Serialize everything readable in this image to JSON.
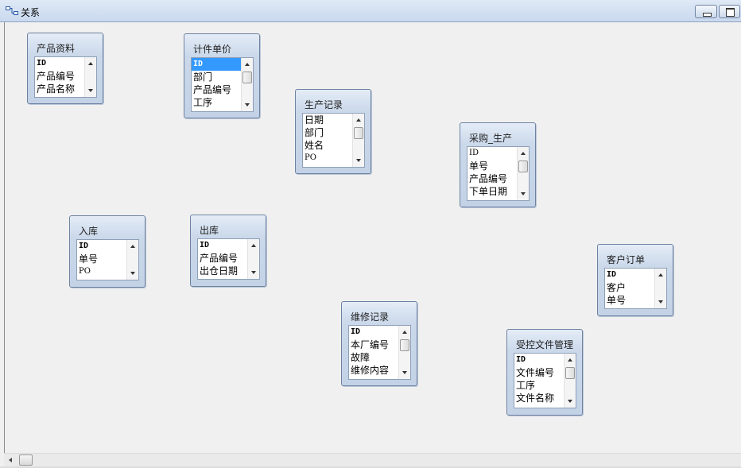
{
  "window": {
    "title": "关系"
  },
  "tables": [
    {
      "id": "chanpin-ziliao",
      "name": "产品资料",
      "fields": [
        "ID",
        "产品编号",
        "产品名称"
      ],
      "scroll_thumb": false
    },
    {
      "id": "jijian-danjia",
      "name": "计件单价",
      "fields": [
        "ID",
        "部门",
        "产品编号",
        "工序"
      ],
      "selected_field": "ID",
      "scroll_thumb": true
    },
    {
      "id": "shengchan-jilu",
      "name": "生产记录",
      "fields": [
        "日期",
        "部门",
        "姓名",
        "PO"
      ],
      "scroll_thumb": true
    },
    {
      "id": "caigou-shengchan",
      "name": "采购_生产",
      "fields": [
        "ID",
        "单号",
        "产品编号",
        "下单日期"
      ],
      "scroll_thumb": true
    },
    {
      "id": "ruku",
      "name": "入库",
      "fields": [
        "ID",
        "单号",
        "PO"
      ],
      "scroll_thumb": false
    },
    {
      "id": "chuku",
      "name": "出库",
      "fields": [
        "ID",
        "产品编号",
        "出仓日期"
      ],
      "scroll_thumb": false
    },
    {
      "id": "kehu-dingdan",
      "name": "客户订单",
      "fields": [
        "ID",
        "客户",
        "单号"
      ],
      "scroll_thumb": false
    },
    {
      "id": "weixiu-jilu",
      "name": "维修记录",
      "fields": [
        "ID",
        "本厂编号",
        "故障",
        "维修内容"
      ],
      "scroll_thumb": true
    },
    {
      "id": "shoukong-wenjian",
      "name": "受控文件管理",
      "fields": [
        "ID",
        "文件编号",
        "工序",
        "文件名称"
      ],
      "scroll_thumb": true
    }
  ],
  "colors": {
    "titlebar": "#c9d9ee",
    "table_header": "#cad8ea",
    "selection": "#3399ff",
    "canvas": "#f0f0f0"
  }
}
